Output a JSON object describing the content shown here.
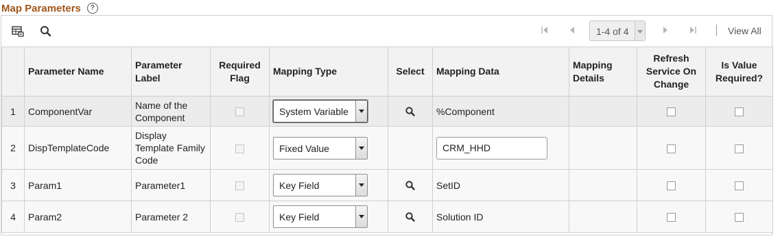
{
  "section": {
    "title": "Map Parameters",
    "help_glyph": "?"
  },
  "toolbar": {
    "pager_text": "1-4 of 4",
    "view_all_label": "View All"
  },
  "columns": {
    "row_num": "",
    "param_name": "Parameter Name",
    "param_label": "Parameter Label",
    "required_flag": "Required Flag",
    "mapping_type": "Mapping Type",
    "select": "Select",
    "mapping_data": "Mapping Data",
    "mapping_details": "Mapping Details",
    "refresh": "Refresh Service On Change",
    "is_value_required": "Is Value Required?"
  },
  "rows": [
    {
      "num": "1",
      "name": "ComponentVar",
      "label": "Name of the Component",
      "mapping_type": "System Variable",
      "mapping_data": "%Component",
      "has_lookup": true,
      "data_editable": false
    },
    {
      "num": "2",
      "name": "DispTemplateCode",
      "label": "Display Template Family Code",
      "mapping_type": "Fixed Value",
      "mapping_data": "CRM_HHD",
      "has_lookup": false,
      "data_editable": true
    },
    {
      "num": "3",
      "name": "Param1",
      "label": "Parameter1",
      "mapping_type": "Key Field",
      "mapping_data": "SetID",
      "has_lookup": true,
      "data_editable": false
    },
    {
      "num": "4",
      "name": "Param2",
      "label": "Parameter 2",
      "mapping_type": "Key Field",
      "mapping_data": "Solution ID",
      "has_lookup": true,
      "data_editable": false
    }
  ],
  "colors": {
    "title": "#a0561b",
    "header_bg": "#f2f2f2",
    "row_alt_bg": "#ececec",
    "border": "#cfcfcf"
  }
}
